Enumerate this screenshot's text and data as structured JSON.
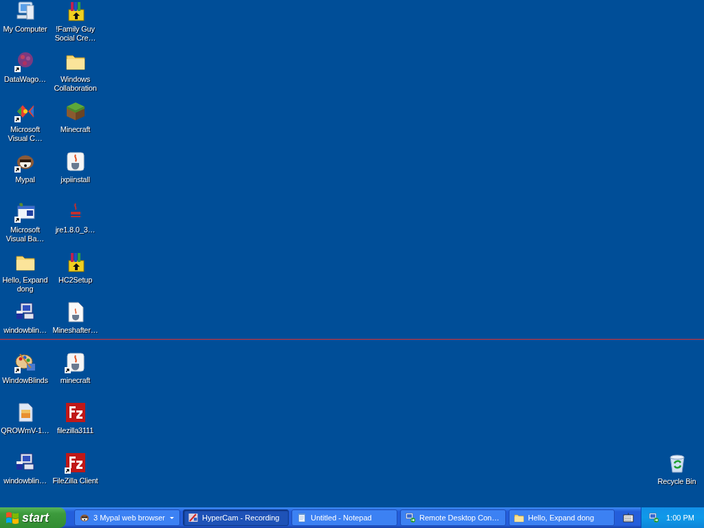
{
  "desktop": {
    "icons": [
      {
        "label": "My Computer",
        "kind": "computer",
        "shortcut": false
      },
      {
        "label": "!Family Guy Social Cre…",
        "kind": "archive",
        "shortcut": false
      },
      {
        "label": "DataWago…",
        "kind": "dots",
        "shortcut": true
      },
      {
        "label": "Windows Collaboration",
        "kind": "folder",
        "shortcut": false
      },
      {
        "label": "Microsoft Visual C…",
        "kind": "studio",
        "shortcut": true
      },
      {
        "label": "Minecraft",
        "kind": "block",
        "shortcut": false
      },
      {
        "label": "Mypal",
        "kind": "raccoon",
        "shortcut": true
      },
      {
        "label": "jxpiinstall",
        "kind": "java",
        "shortcut": false
      },
      {
        "label": "Microsoft Visual Ba…",
        "kind": "vb",
        "shortcut": true
      },
      {
        "label": "jre1.8.0_3…",
        "kind": "javalogo",
        "shortcut": false
      },
      {
        "label": "Hello, Expand dong",
        "kind": "folder",
        "shortcut": false
      },
      {
        "label": "HC2Setup",
        "kind": "archive",
        "shortcut": false
      },
      {
        "label": "windowblin…",
        "kind": "installer",
        "shortcut": false
      },
      {
        "label": "Mineshafter…",
        "kind": "javadoc",
        "shortcut": false
      },
      {
        "label": "WindowBlinds",
        "kind": "palette",
        "shortcut": true
      },
      {
        "label": "minecraft",
        "kind": "java",
        "shortcut": true
      },
      {
        "label": "QROWmV-1…",
        "kind": "image",
        "shortcut": false
      },
      {
        "label": "filezilla3111",
        "kind": "filezilla",
        "shortcut": false
      },
      {
        "label": "windowblin…",
        "kind": "installer",
        "shortcut": false
      },
      {
        "label": "FileZilla Client",
        "kind": "filezilla",
        "shortcut": true
      }
    ],
    "corner_icons": [
      {
        "label": "Recycle Bin",
        "kind": "bin",
        "shortcut": false
      }
    ]
  },
  "taskbar": {
    "start": {
      "label": "start"
    },
    "tasks": [
      {
        "label": "3 Mypal web browser",
        "kind": "raccoon",
        "selected": false,
        "grouped": true
      },
      {
        "label": "HyperCam - Recording",
        "kind": "camera",
        "selected": true,
        "grouped": false
      },
      {
        "label": "Untitled - Notepad",
        "kind": "notepad",
        "selected": false,
        "grouped": false
      },
      {
        "label": "Remote Desktop Con…",
        "kind": "remote",
        "selected": false,
        "grouped": false
      },
      {
        "label": "Hello, Expand dong",
        "kind": "folder",
        "selected": false,
        "grouped": false
      }
    ],
    "tray": {
      "time": "1:00 PM"
    }
  }
}
